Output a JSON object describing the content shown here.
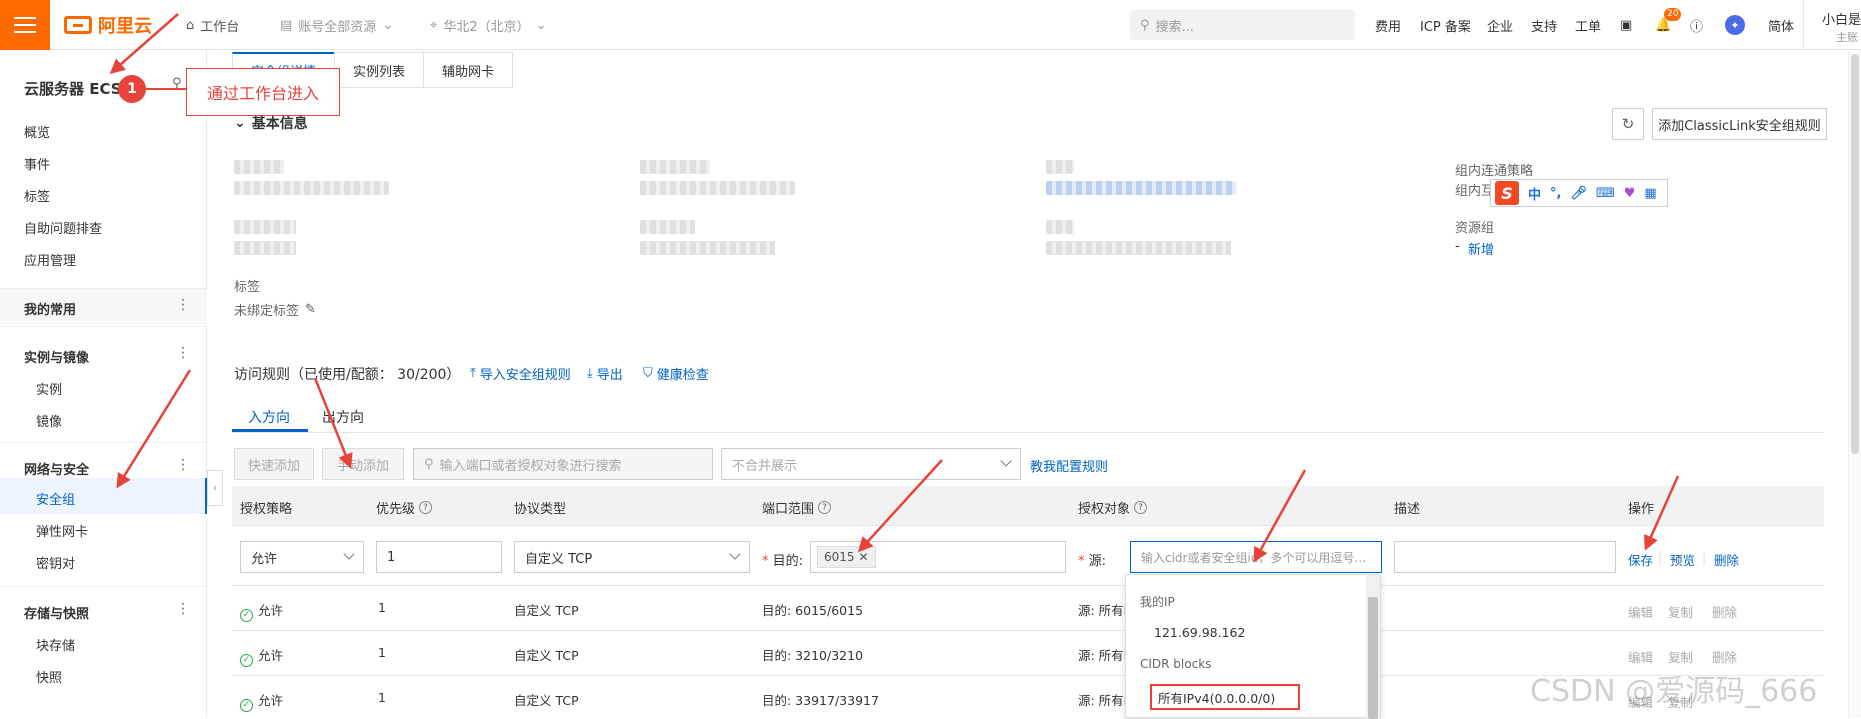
{
  "topbar": {
    "logo_text": "阿里云",
    "workbench": "工作台",
    "account_resources": "账号全部资源",
    "region": "华北2（北京）",
    "search_placeholder": "搜索...",
    "nav": [
      "费用",
      "ICP 备案",
      "企业",
      "支持",
      "工单"
    ],
    "notify_count": "20",
    "lang": "简体",
    "user_name": "小白是",
    "user_role": "主账"
  },
  "sidebar": {
    "title": "云服务器 ECS",
    "items": [
      "概览",
      "事件",
      "标签",
      "自助问题排查",
      "应用管理"
    ],
    "my_common": "我的常用",
    "group_instance": "实例与镜像",
    "instance_items": [
      "实例",
      "镜像"
    ],
    "group_network": "网络与安全",
    "network_items": [
      "安全组",
      "弹性网卡",
      "密钥对"
    ],
    "group_storage": "存储与快照",
    "storage_items": [
      "块存储",
      "快照"
    ]
  },
  "annotation": {
    "number": "1",
    "text": "通过工作台进入"
  },
  "tabs": [
    "安全组详情",
    "实例列表",
    "辅助网卡"
  ],
  "basic_info": {
    "title": "基本信息",
    "add_classic_btn": "添加ClassicLink安全组规则",
    "intra_policy_label": "组内连通策略",
    "intra_label": "组内互",
    "resource_group_label": "资源组",
    "resource_group_dash": "-",
    "resource_group_new": "新增",
    "tags_label": "标签",
    "tags_value": "未绑定标签"
  },
  "ime": {
    "s": "S",
    "zh": "中",
    "punct": "°,"
  },
  "rules": {
    "title": "访问规则（已使用/配额： 30/200）",
    "import": "导入安全组规则",
    "export": "导出",
    "health": "健康检查",
    "dir_in": "入方向",
    "dir_out": "出方向",
    "quick_add": "快速添加",
    "manual_add": "手动添加",
    "search_placeholder": "输入端口或者授权对象进行搜索",
    "merge_select": "不合并展示",
    "teach_link": "教我配置规则"
  },
  "table": {
    "headers": [
      "授权策略",
      "优先级",
      "协议类型",
      "端口范围",
      "授权对象",
      "描述",
      "操作"
    ],
    "edit_row": {
      "policy": "允许",
      "priority": "1",
      "protocol": "自定义 TCP",
      "dest_label": "目的:",
      "port_tag": "6015",
      "source_label": "源:",
      "source_placeholder": "输入cidr或者安全组id，多个可以用逗号...",
      "desc": "",
      "save": "保存",
      "preview": "预览",
      "delete": "删除"
    },
    "rows": [
      {
        "policy": "允许",
        "priority": "1",
        "protocol": "自定义 TCP",
        "port": "目的: 6015/6015",
        "source": "源: 所有IP"
      },
      {
        "policy": "允许",
        "priority": "1",
        "protocol": "自定义 TCP",
        "port": "目的: 3210/3210",
        "source": "源: 所有IP"
      },
      {
        "policy": "允许",
        "priority": "1",
        "protocol": "自定义 TCP",
        "port": "目的: 33917/33917",
        "source": "源: 所有IP"
      }
    ],
    "row_ops": [
      "编辑",
      "复制",
      "删除"
    ]
  },
  "dropdown": {
    "my_ip_label": "我的IP",
    "my_ip": "121.69.98.162",
    "cidr_label": "CIDR blocks",
    "all_ipv4": "所有IPv4(0.0.0.0/0)"
  },
  "watermark": "CSDN @爱源码_666",
  "colors": {
    "brand": "#ff6a00",
    "link": "#0064c8",
    "annotation": "#e8433b",
    "ok": "#25a84a"
  }
}
